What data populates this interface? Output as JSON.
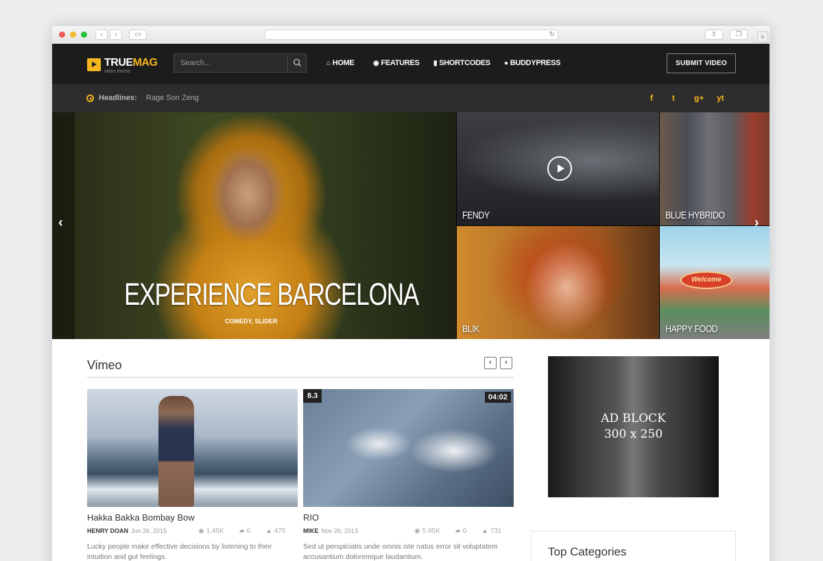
{
  "header": {
    "logo_main": "TRUE",
    "logo_accent": "MAG",
    "logo_sub": "video theme",
    "search_placeholder": "Search...",
    "nav": [
      {
        "label": "HOME",
        "icon": "home-icon"
      },
      {
        "label": "FEATURES",
        "icon": "play-circle-icon"
      },
      {
        "label": "SHORTCODES",
        "icon": "bookmark-icon"
      },
      {
        "label": "BUDDYPRESS",
        "icon": "user-icon"
      }
    ],
    "submit_label": "SUBMIT VIDEO"
  },
  "headlines": {
    "label": "Headlines:",
    "text": "Rage Son Zeng",
    "social": [
      "f",
      "t",
      "g+",
      "yt"
    ]
  },
  "slider": {
    "hero_title": "EXPERIENCE BARCELONA",
    "hero_categories": "COMEDY, SLIDER",
    "tiles": [
      "FENDY",
      "BLUE HYBRIDO",
      "BLIK",
      "HAPPY FOOD"
    ],
    "welcome_sign": "Welcome"
  },
  "section": {
    "title": "Vimeo",
    "cards": [
      {
        "title": "Hakka Bakka Bombay Bow",
        "author": "HENRY DOAN",
        "date": "Jun 26, 2015",
        "views": "1.45K",
        "comments": "0",
        "likes": "475",
        "excerpt": "Lucky people make effective decisions by listening to their intuition and gut feelings."
      },
      {
        "title": "RIO",
        "author": "MIKE",
        "date": "Nov 26, 2013",
        "views": "5.95K",
        "comments": "0",
        "likes": "731",
        "rating": "8.3",
        "duration": "04:02",
        "excerpt": "Sed ut perspiciatis unde omnis iste natus error sit voluptatem accusantium doloremque laudantium."
      }
    ]
  },
  "sidebar": {
    "ad_line1": "AD BLOCK",
    "ad_line2": "300 x 250",
    "top_categories": "Top Categories"
  },
  "colors": {
    "accent": "#f5b51e",
    "header_bg": "#1c1c1c",
    "headline_bg": "#2d2d2d"
  }
}
